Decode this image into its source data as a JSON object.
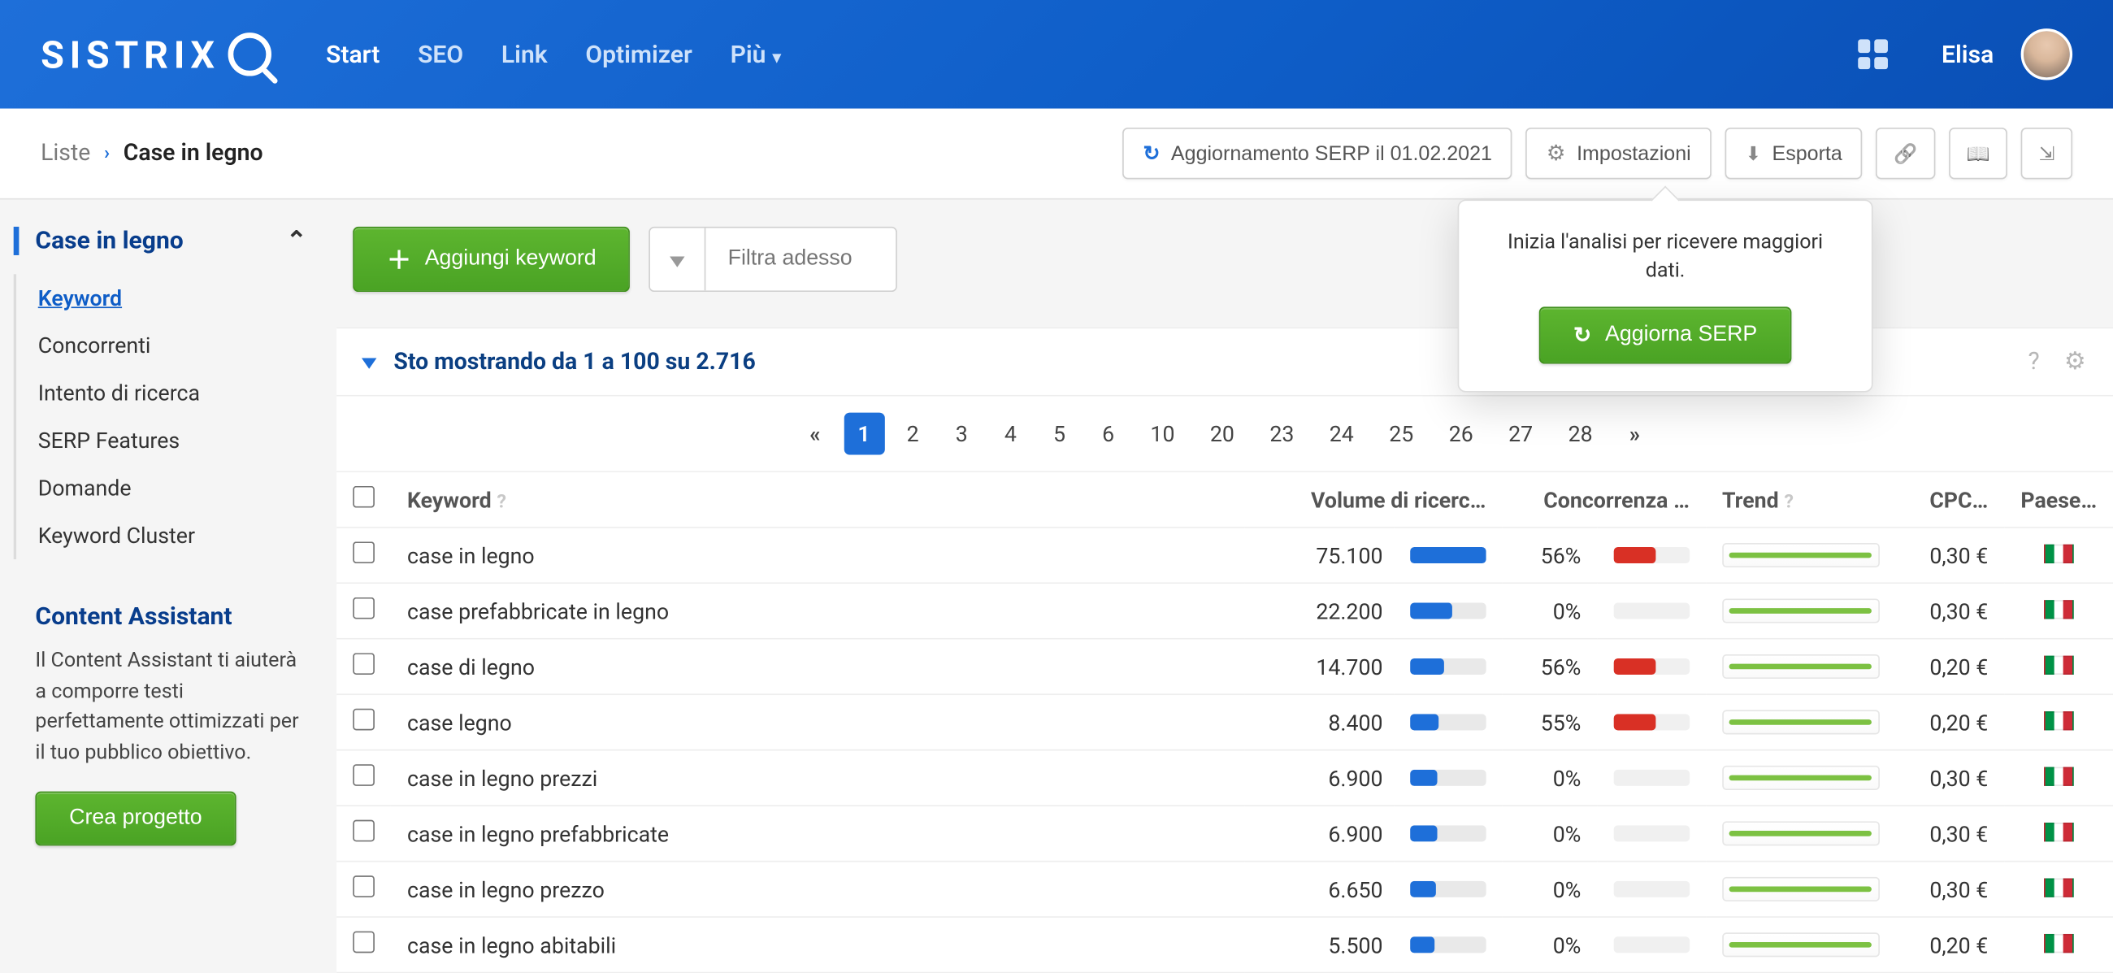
{
  "brand": "SISTRIX",
  "nav": {
    "items": [
      "Start",
      "SEO",
      "Link",
      "Optimizer",
      "Più"
    ],
    "active": "Start",
    "user": "Elisa"
  },
  "breadcrumb": {
    "root": "Liste",
    "current": "Case in legno"
  },
  "action_bar": {
    "refresh": "Aggiornamento SERP il 01.02.2021",
    "settings": "Impostazioni",
    "export": "Esporta"
  },
  "popover": {
    "text": "Inizia l'analisi per ricevere maggiori dati.",
    "button": "Aggiorna SERP"
  },
  "sidebar": {
    "title": "Case in legno",
    "items": [
      "Keyword",
      "Concorrenti",
      "Intento di ricerca",
      "SERP Features",
      "Domande",
      "Keyword Cluster"
    ],
    "active": "Keyword",
    "assist_title": "Content Assistant",
    "assist_text": "Il Content Assistant ti aiuterà a comporre testi perfettamente ottimizzati per il tuo pubblico obiettivo.",
    "assist_button": "Crea progetto"
  },
  "toolbar": {
    "add_keyword": "Aggiungi keyword",
    "filter_placeholder": "Filtra adesso"
  },
  "info_strip": "Sto mostrando da 1 a 100 su 2.716",
  "pager": {
    "pages": [
      "1",
      "2",
      "3",
      "4",
      "5",
      "6",
      "10",
      "20",
      "23",
      "24",
      "25",
      "26",
      "27",
      "28"
    ],
    "current": "1"
  },
  "table": {
    "columns": {
      "keyword": "Keyword",
      "volume": "Volume di ricerc…",
      "competition": "Concorrenza …",
      "trend": "Trend",
      "cpc": "CPC…",
      "country": "Paese…"
    },
    "rows": [
      {
        "keyword": "case in legno",
        "volume": "75.100",
        "vol_pct": 100,
        "comp": "56%",
        "comp_pct": 56,
        "cpc": "0,30 €"
      },
      {
        "keyword": "case prefabbricate in legno",
        "volume": "22.200",
        "vol_pct": 55,
        "comp": "0%",
        "comp_pct": 0,
        "cpc": "0,30 €"
      },
      {
        "keyword": "case di legno",
        "volume": "14.700",
        "vol_pct": 45,
        "comp": "56%",
        "comp_pct": 56,
        "cpc": "0,20 €"
      },
      {
        "keyword": "case legno",
        "volume": "8.400",
        "vol_pct": 38,
        "comp": "55%",
        "comp_pct": 55,
        "cpc": "0,20 €"
      },
      {
        "keyword": "case in legno prezzi",
        "volume": "6.900",
        "vol_pct": 36,
        "comp": "0%",
        "comp_pct": 0,
        "cpc": "0,30 €"
      },
      {
        "keyword": "case in legno prefabbricate",
        "volume": "6.900",
        "vol_pct": 36,
        "comp": "0%",
        "comp_pct": 0,
        "cpc": "0,30 €"
      },
      {
        "keyword": "case in legno prezzo",
        "volume": "6.650",
        "vol_pct": 35,
        "comp": "0%",
        "comp_pct": 0,
        "cpc": "0,30 €"
      },
      {
        "keyword": "case in legno abitabili",
        "volume": "5.500",
        "vol_pct": 32,
        "comp": "0%",
        "comp_pct": 0,
        "cpc": "0,20 €"
      }
    ]
  }
}
